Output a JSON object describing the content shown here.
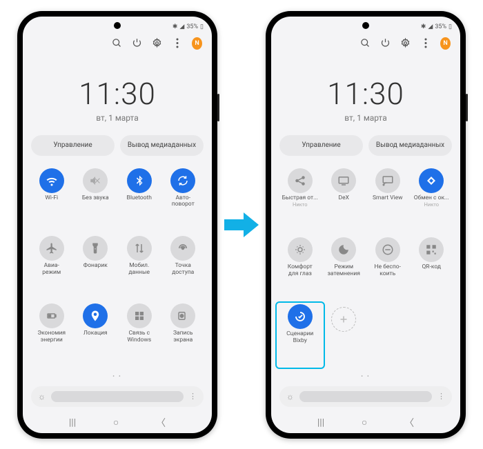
{
  "statusbar": {
    "battery": "35%",
    "indicators": "⁂◢"
  },
  "toolbar": {
    "badge": "N"
  },
  "clock": {
    "time": "11:30",
    "date": "вт, 1 марта"
  },
  "panel": {
    "left": "Управление",
    "right": "Вывод медиаданных"
  },
  "left_tiles": [
    {
      "label": "Wi-Fi",
      "icon": "wifi",
      "active": true
    },
    {
      "label": "Без звука",
      "icon": "mute",
      "active": false
    },
    {
      "label": "Bluetooth",
      "icon": "bluetooth",
      "active": true
    },
    {
      "label": "Авто-\nповорот",
      "icon": "rotate",
      "active": true
    },
    {
      "label": "Авиа-\nрежим",
      "icon": "plane",
      "active": false
    },
    {
      "label": "Фонарик",
      "icon": "torch",
      "active": false
    },
    {
      "label": "Мобил.\nданные",
      "icon": "data",
      "active": false
    },
    {
      "label": "Точка\nдоступа",
      "icon": "hotspot",
      "active": false
    },
    {
      "label": "Экономия\nэнергии",
      "icon": "battery",
      "active": false
    },
    {
      "label": "Локация",
      "icon": "location",
      "active": true
    },
    {
      "label": "Связь с\nWindows",
      "icon": "windows",
      "active": false
    },
    {
      "label": "Запись\nэкрана",
      "icon": "record",
      "active": false
    }
  ],
  "right_tiles": [
    {
      "label": "Быстрая от...",
      "sub": "Никто",
      "icon": "share",
      "active": false
    },
    {
      "label": "DeX",
      "icon": "dex",
      "active": false
    },
    {
      "label": "Smart View",
      "icon": "smartview",
      "active": false
    },
    {
      "label": "Обмен с ок...",
      "sub": "Никто",
      "icon": "nearby",
      "active": true
    },
    {
      "label": "Комфорт\nдля глаз",
      "icon": "eye",
      "active": false
    },
    {
      "label": "Режим\nзатемнения",
      "icon": "dark",
      "active": false
    },
    {
      "label": "Не беспо-\nкоить",
      "icon": "dnd",
      "active": false
    },
    {
      "label": "QR-код",
      "icon": "qr",
      "active": false
    },
    {
      "label": "Сценарии\nBixby",
      "icon": "bixby",
      "active": true,
      "highlight": true
    },
    {
      "label": "",
      "icon": "add",
      "add": true
    }
  ]
}
